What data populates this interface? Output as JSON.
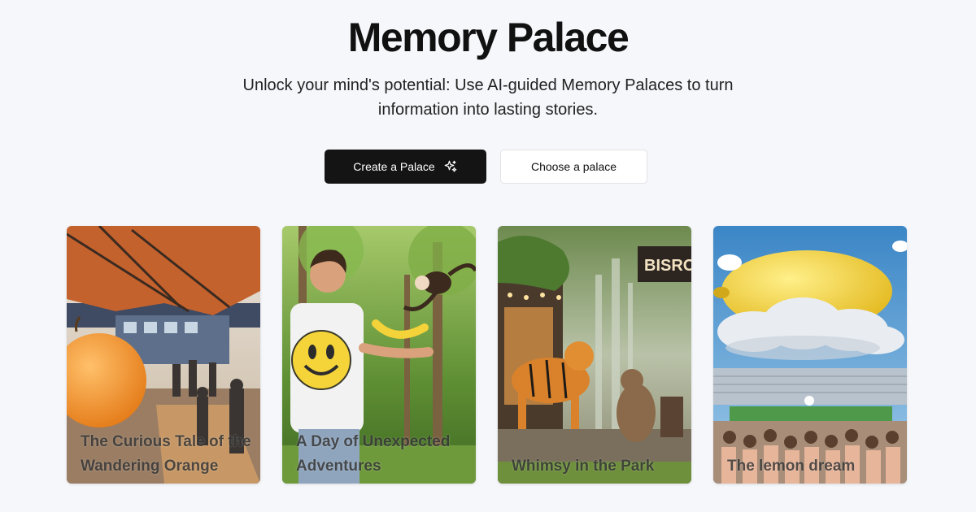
{
  "hero": {
    "title": "Memory Palace",
    "subtitle": "Unlock your mind's potential: Use AI-guided Memory Palaces to turn information into lasting stories."
  },
  "actions": {
    "create_label": "Create a Palace",
    "create_icon": "sparkles-icon",
    "choose_label": "Choose a palace"
  },
  "palaces": [
    {
      "title": "The Curious Tale of the Wandering Orange",
      "scene": "orange at a train station under an umbrella"
    },
    {
      "title": "A Day of Unexpected Adventures",
      "scene": "man in smiley shirt with monkey and banana in forest"
    },
    {
      "title": "Whimsy in the Park",
      "scene": "tiger and bear near a bistro in a park"
    },
    {
      "title": "The lemon dream",
      "scene": "giant lemon on a cloud over a stadium crowd"
    }
  ],
  "colors": {
    "background": "#f6f7fb",
    "primary_button": "#141414",
    "secondary_button": "#ffffff"
  }
}
